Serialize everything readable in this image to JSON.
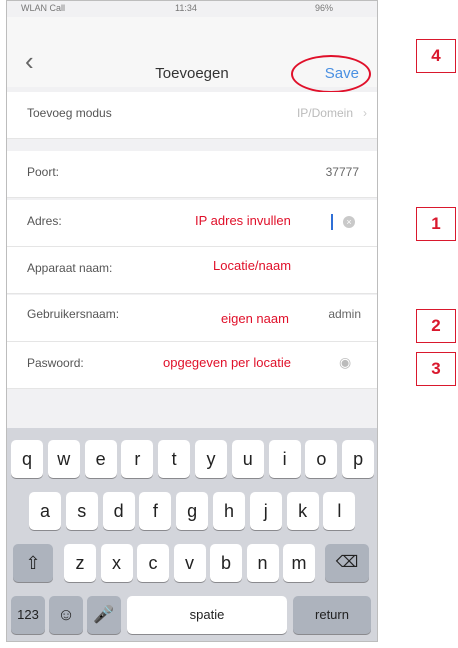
{
  "status_bar": {
    "carrier": "WLAN Call",
    "time": "11:34",
    "battery": "96%"
  },
  "nav": {
    "back_icon": "chevron-left",
    "title": "Toevoegen",
    "save_label": "Save"
  },
  "form": {
    "mode": {
      "label": "Toevoeg modus",
      "value": "IP/Domein"
    },
    "port": {
      "label": "Poort:",
      "value": "37777"
    },
    "address": {
      "label": "Adres:",
      "annotation": "IP adres invullen"
    },
    "device_name": {
      "label": "Apparaat naam:",
      "annotation": "Locatie/naam"
    },
    "username": {
      "label": "Gebruikersnaam:",
      "annotation": "eigen naam",
      "value": "admin"
    },
    "password": {
      "label": "Paswoord:",
      "annotation": "opgegeven per locatie"
    }
  },
  "keyboard": {
    "row1": [
      "q",
      "w",
      "e",
      "r",
      "t",
      "y",
      "u",
      "i",
      "o",
      "p"
    ],
    "row2": [
      "a",
      "s",
      "d",
      "f",
      "g",
      "h",
      "j",
      "k",
      "l"
    ],
    "row3": [
      "z",
      "x",
      "c",
      "v",
      "b",
      "n",
      "m"
    ],
    "numbers_label": "123",
    "space_label": "spatie",
    "return_label": "return"
  },
  "badges": {
    "b1": "1",
    "b2": "2",
    "b3": "3",
    "b4": "4"
  },
  "colors": {
    "accent": "#4a90e2",
    "annotation": "#e0102a"
  }
}
